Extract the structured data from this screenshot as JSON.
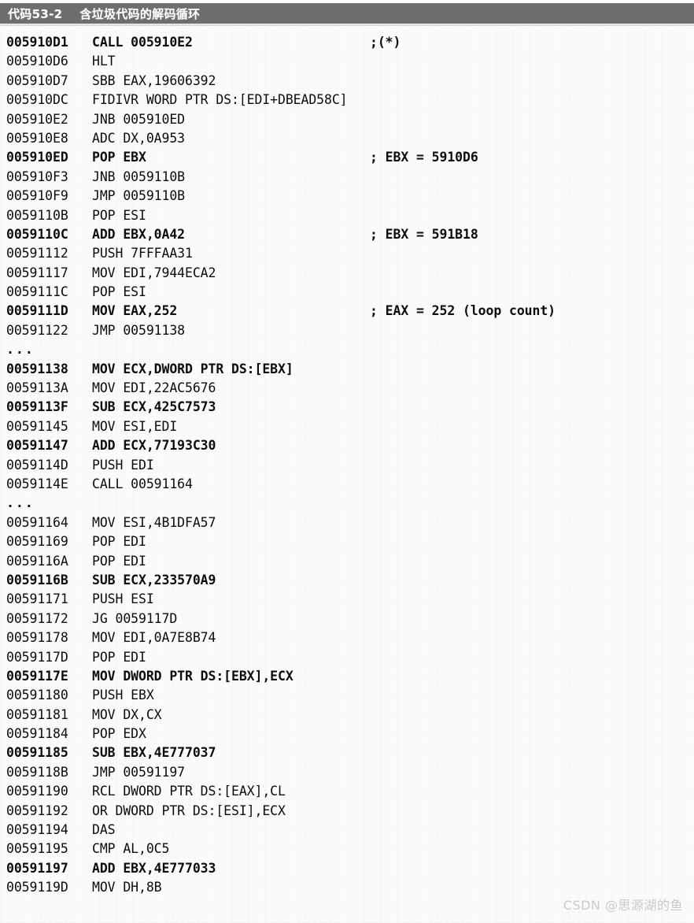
{
  "caption": {
    "label": "代码53-2",
    "title": "含垃圾代码的解码循环"
  },
  "watermark": "CSDN @思源湖的鱼",
  "listing": {
    "columns": [
      "address",
      "instruction",
      "comment"
    ],
    "lines": [
      {
        "address": "005910D1",
        "instruction": "CALL 005910E2",
        "comment": ";(*)",
        "bold": true
      },
      {
        "address": "005910D6",
        "instruction": "HLT",
        "comment": "",
        "bold": false
      },
      {
        "address": "005910D7",
        "instruction": "SBB EAX,19606392",
        "comment": "",
        "bold": false
      },
      {
        "address": "005910DC",
        "instruction": "FIDIVR WORD PTR DS:[EDI+DBEAD58C]",
        "comment": "",
        "bold": false
      },
      {
        "address": "005910E2",
        "instruction": "JNB 005910ED",
        "comment": "",
        "bold": false
      },
      {
        "address": "005910E8",
        "instruction": "ADC DX,0A953",
        "comment": "",
        "bold": false
      },
      {
        "address": "005910ED",
        "instruction": "POP EBX",
        "comment": "; EBX = 5910D6",
        "bold": true
      },
      {
        "address": "005910F3",
        "instruction": "JNB 0059110B",
        "comment": "",
        "bold": false
      },
      {
        "address": "005910F9",
        "instruction": "JMP 0059110B",
        "comment": "",
        "bold": false
      },
      {
        "address": "0059110B",
        "instruction": "POP ESI",
        "comment": "",
        "bold": false
      },
      {
        "address": "0059110C",
        "instruction": "ADD EBX,0A42",
        "comment": "; EBX = 591B18",
        "bold": true
      },
      {
        "address": "00591112",
        "instruction": "PUSH 7FFFAA31",
        "comment": "",
        "bold": false
      },
      {
        "address": "00591117",
        "instruction": "MOV EDI,7944ECA2",
        "comment": "",
        "bold": false
      },
      {
        "address": "0059111C",
        "instruction": "POP ESI",
        "comment": "",
        "bold": false
      },
      {
        "address": "0059111D",
        "instruction": "MOV EAX,252",
        "comment": "; EAX = 252 (loop count)",
        "bold": true
      },
      {
        "address": "00591122",
        "instruction": "JMP 00591138",
        "comment": "",
        "bold": false
      },
      {
        "address": "...",
        "instruction": "",
        "comment": "",
        "bold": false,
        "ellipsis": true
      },
      {
        "address": "00591138",
        "instruction": "MOV ECX,DWORD PTR DS:[EBX]",
        "comment": "",
        "bold": true
      },
      {
        "address": "0059113A",
        "instruction": "MOV EDI,22AC5676",
        "comment": "",
        "bold": false
      },
      {
        "address": "0059113F",
        "instruction": "SUB ECX,425C7573",
        "comment": "",
        "bold": true
      },
      {
        "address": "00591145",
        "instruction": "MOV ESI,EDI",
        "comment": "",
        "bold": false
      },
      {
        "address": "00591147",
        "instruction": "ADD ECX,77193C30",
        "comment": "",
        "bold": true
      },
      {
        "address": "0059114D",
        "instruction": "PUSH EDI",
        "comment": "",
        "bold": false
      },
      {
        "address": "0059114E",
        "instruction": "CALL 00591164",
        "comment": "",
        "bold": false
      },
      {
        "address": "...",
        "instruction": "",
        "comment": "",
        "bold": false,
        "ellipsis": true
      },
      {
        "address": "00591164",
        "instruction": "MOV ESI,4B1DFA57",
        "comment": "",
        "bold": false
      },
      {
        "address": "00591169",
        "instruction": "POP EDI",
        "comment": "",
        "bold": false
      },
      {
        "address": "0059116A",
        "instruction": "POP EDI",
        "comment": "",
        "bold": false
      },
      {
        "address": "0059116B",
        "instruction": "SUB ECX,233570A9",
        "comment": "",
        "bold": true
      },
      {
        "address": "00591171",
        "instruction": "PUSH ESI",
        "comment": "",
        "bold": false
      },
      {
        "address": "00591172",
        "instruction": "JG 0059117D",
        "comment": "",
        "bold": false
      },
      {
        "address": "00591178",
        "instruction": "MOV EDI,0A7E8B74",
        "comment": "",
        "bold": false
      },
      {
        "address": "0059117D",
        "instruction": "POP EDI",
        "comment": "",
        "bold": false
      },
      {
        "address": "0059117E",
        "instruction": "MOV DWORD PTR DS:[EBX],ECX",
        "comment": "",
        "bold": true
      },
      {
        "address": "00591180",
        "instruction": "PUSH EBX",
        "comment": "",
        "bold": false
      },
      {
        "address": "00591181",
        "instruction": "MOV DX,CX",
        "comment": "",
        "bold": false
      },
      {
        "address": "00591184",
        "instruction": "POP EDX",
        "comment": "",
        "bold": false
      },
      {
        "address": "00591185",
        "instruction": "SUB EBX,4E777037",
        "comment": "",
        "bold": true
      },
      {
        "address": "0059118B",
        "instruction": "JMP 00591197",
        "comment": "",
        "bold": false
      },
      {
        "address": "00591190",
        "instruction": "RCL DWORD PTR DS:[EAX],CL",
        "comment": "",
        "bold": false
      },
      {
        "address": "00591192",
        "instruction": "OR DWORD PTR DS:[ESI],ECX",
        "comment": "",
        "bold": false
      },
      {
        "address": "00591194",
        "instruction": "DAS",
        "comment": "",
        "bold": false
      },
      {
        "address": "00591195",
        "instruction": "CMP AL,0C5",
        "comment": "",
        "bold": false
      },
      {
        "address": "00591197",
        "instruction": "ADD EBX,4E777033",
        "comment": "",
        "bold": true
      },
      {
        "address": "0059119D",
        "instruction": "MOV DH,8B",
        "comment": "",
        "bold": false
      }
    ]
  }
}
